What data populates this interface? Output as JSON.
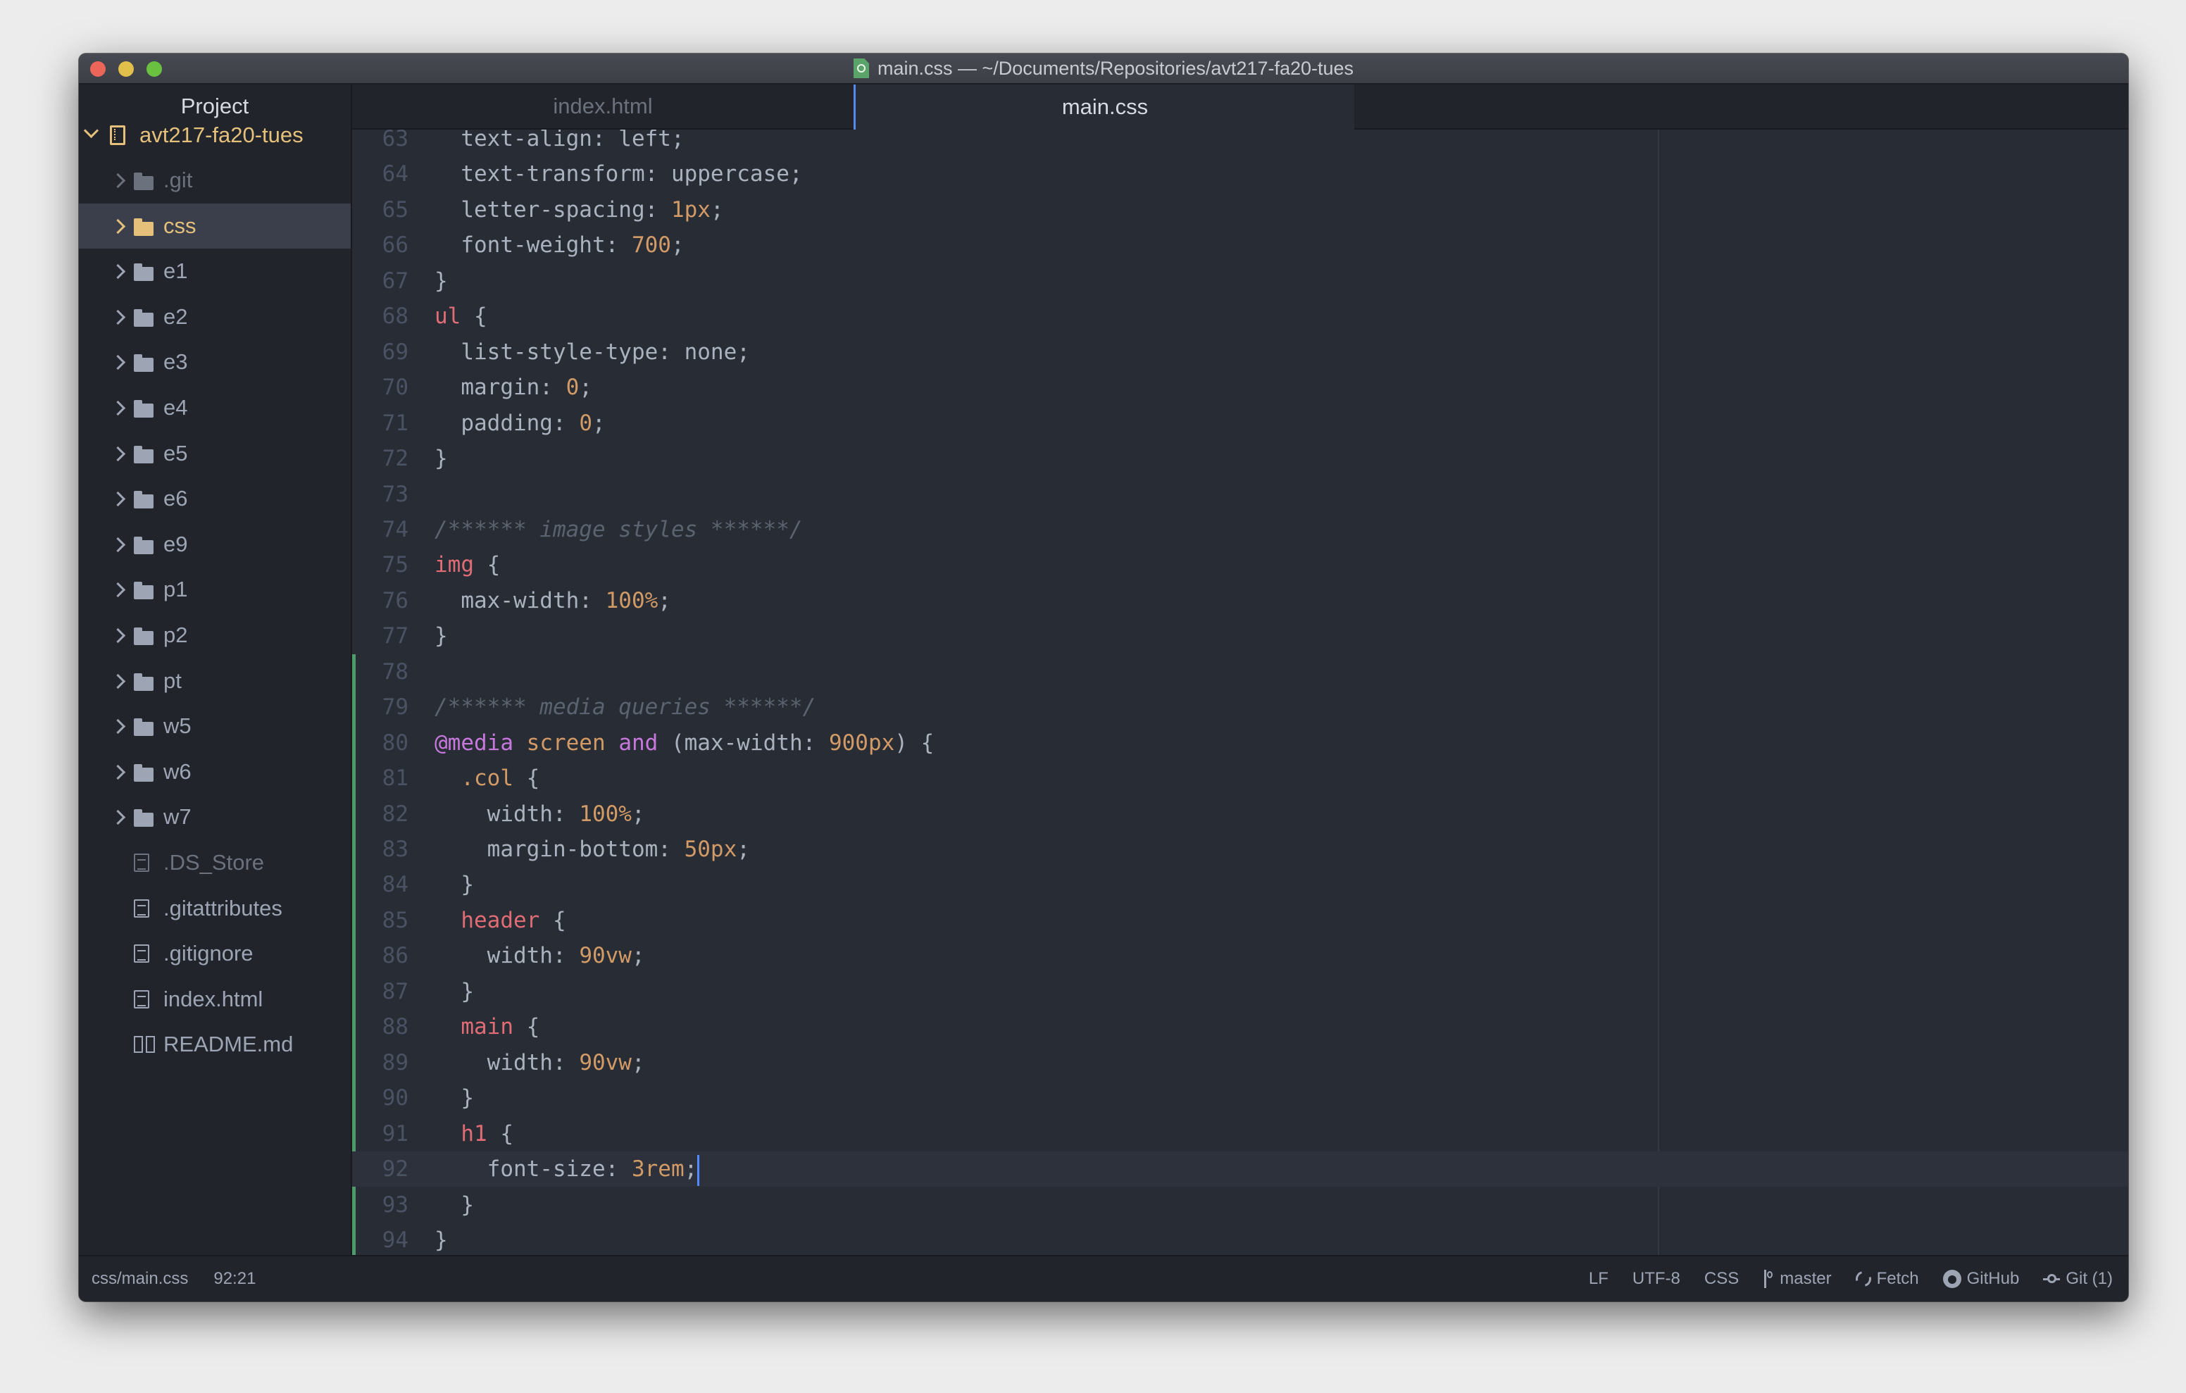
{
  "window": {
    "title": "main.css — ~/Documents/Repositories/avt217-fa20-tues",
    "title_icon": "atom-file-icon"
  },
  "sidebar": {
    "header": "Project",
    "root": {
      "label": "avt217-fa20-tues",
      "icon": "repo-icon",
      "expanded": true
    },
    "items": [
      {
        "label": ".git",
        "type": "folder",
        "state": "ignored"
      },
      {
        "label": "css",
        "type": "folder",
        "state": "modified",
        "selected": true
      },
      {
        "label": "e1",
        "type": "folder"
      },
      {
        "label": "e2",
        "type": "folder"
      },
      {
        "label": "e3",
        "type": "folder"
      },
      {
        "label": "e4",
        "type": "folder"
      },
      {
        "label": "e5",
        "type": "folder"
      },
      {
        "label": "e6",
        "type": "folder"
      },
      {
        "label": "e9",
        "type": "folder"
      },
      {
        "label": "p1",
        "type": "folder"
      },
      {
        "label": "p2",
        "type": "folder"
      },
      {
        "label": "pt",
        "type": "folder"
      },
      {
        "label": "w5",
        "type": "folder"
      },
      {
        "label": "w6",
        "type": "folder"
      },
      {
        "label": "w7",
        "type": "folder"
      },
      {
        "label": ".DS_Store",
        "type": "file",
        "state": "ignored"
      },
      {
        "label": ".gitattributes",
        "type": "file"
      },
      {
        "label": ".gitignore",
        "type": "file"
      },
      {
        "label": "index.html",
        "type": "file"
      },
      {
        "label": "README.md",
        "type": "book"
      }
    ]
  },
  "tabs": [
    {
      "label": "index.html",
      "active": false
    },
    {
      "label": "main.css",
      "active": true
    }
  ],
  "editor": {
    "cursor_line": 92,
    "lines": [
      {
        "n": "63",
        "tokens": [
          [
            "plain",
            "  text-align: left;"
          ]
        ]
      },
      {
        "n": "64",
        "tokens": [
          [
            "plain",
            "  text-transform: uppercase;"
          ]
        ]
      },
      {
        "n": "65",
        "tokens": [
          [
            "plain",
            "  letter-spacing: "
          ],
          [
            "num",
            "1px"
          ],
          [
            "plain",
            ";"
          ]
        ]
      },
      {
        "n": "66",
        "tokens": [
          [
            "plain",
            "  font-weight: "
          ],
          [
            "num",
            "700"
          ],
          [
            "plain",
            ";"
          ]
        ]
      },
      {
        "n": "67",
        "tokens": [
          [
            "plain",
            "}"
          ]
        ]
      },
      {
        "n": "68",
        "tokens": [
          [
            "sel",
            "ul"
          ],
          [
            "plain",
            " {"
          ]
        ]
      },
      {
        "n": "69",
        "tokens": [
          [
            "plain",
            "  list-style-type: none;"
          ]
        ]
      },
      {
        "n": "70",
        "tokens": [
          [
            "plain",
            "  margin: "
          ],
          [
            "num",
            "0"
          ],
          [
            "plain",
            ";"
          ]
        ]
      },
      {
        "n": "71",
        "tokens": [
          [
            "plain",
            "  padding: "
          ],
          [
            "num",
            "0"
          ],
          [
            "plain",
            ";"
          ]
        ]
      },
      {
        "n": "72",
        "tokens": [
          [
            "plain",
            "}"
          ]
        ]
      },
      {
        "n": "73",
        "tokens": []
      },
      {
        "n": "74",
        "tokens": [
          [
            "com",
            "/****** image styles ******/"
          ]
        ]
      },
      {
        "n": "75",
        "tokens": [
          [
            "sel",
            "img"
          ],
          [
            "plain",
            " {"
          ]
        ]
      },
      {
        "n": "76",
        "tokens": [
          [
            "plain",
            "  max-width: "
          ],
          [
            "num",
            "100%"
          ],
          [
            "plain",
            ";"
          ]
        ]
      },
      {
        "n": "77",
        "tokens": [
          [
            "plain",
            "}"
          ]
        ]
      },
      {
        "n": "78",
        "tokens": []
      },
      {
        "n": "79",
        "tokens": [
          [
            "com",
            "/****** media queries ******/"
          ]
        ]
      },
      {
        "n": "80",
        "tokens": [
          [
            "at",
            "@media"
          ],
          [
            "plain",
            " "
          ],
          [
            "cls",
            "screen"
          ],
          [
            "plain",
            " "
          ],
          [
            "at",
            "and"
          ],
          [
            "plain",
            " (max-width: "
          ],
          [
            "num",
            "900px"
          ],
          [
            "plain",
            ") {"
          ]
        ]
      },
      {
        "n": "81",
        "tokens": [
          [
            "plain",
            "  "
          ],
          [
            "cls",
            ".col"
          ],
          [
            "plain",
            " {"
          ]
        ]
      },
      {
        "n": "82",
        "tokens": [
          [
            "plain",
            "    width: "
          ],
          [
            "num",
            "100%"
          ],
          [
            "plain",
            ";"
          ]
        ]
      },
      {
        "n": "83",
        "tokens": [
          [
            "plain",
            "    margin-bottom: "
          ],
          [
            "num",
            "50px"
          ],
          [
            "plain",
            ";"
          ]
        ]
      },
      {
        "n": "84",
        "tokens": [
          [
            "plain",
            "  }"
          ]
        ]
      },
      {
        "n": "85",
        "tokens": [
          [
            "plain",
            "  "
          ],
          [
            "sel",
            "header"
          ],
          [
            "plain",
            " {"
          ]
        ]
      },
      {
        "n": "86",
        "tokens": [
          [
            "plain",
            "    width: "
          ],
          [
            "num",
            "90vw"
          ],
          [
            "plain",
            ";"
          ]
        ]
      },
      {
        "n": "87",
        "tokens": [
          [
            "plain",
            "  }"
          ]
        ]
      },
      {
        "n": "88",
        "tokens": [
          [
            "plain",
            "  "
          ],
          [
            "sel",
            "main"
          ],
          [
            "plain",
            " {"
          ]
        ]
      },
      {
        "n": "89",
        "tokens": [
          [
            "plain",
            "    width: "
          ],
          [
            "num",
            "90vw"
          ],
          [
            "plain",
            ";"
          ]
        ]
      },
      {
        "n": "90",
        "tokens": [
          [
            "plain",
            "  }"
          ]
        ]
      },
      {
        "n": "91",
        "tokens": [
          [
            "plain",
            "  "
          ],
          [
            "sel",
            "h1"
          ],
          [
            "plain",
            " {"
          ]
        ]
      },
      {
        "n": "92",
        "tokens": [
          [
            "plain",
            "    font-size: "
          ],
          [
            "num",
            "3rem"
          ],
          [
            "plain",
            ";"
          ]
        ]
      },
      {
        "n": "93",
        "tokens": [
          [
            "plain",
            "  }"
          ]
        ]
      },
      {
        "n": "94",
        "tokens": [
          [
            "plain",
            "}"
          ]
        ]
      }
    ],
    "git_added_from_line": 78
  },
  "status": {
    "file_path": "css/main.css",
    "cursor_position": "92:21",
    "line_ending": "LF",
    "encoding": "UTF-8",
    "grammar": "CSS",
    "branch": "master",
    "fetch": "Fetch",
    "github": "GitHub",
    "git": "Git (1)"
  },
  "colors": {
    "accent": "#568af2",
    "modified": "#e5c07b",
    "git_added": "#4f9a6a",
    "selector": "#e06c75",
    "number": "#d19a66",
    "at_rule": "#c678dd",
    "comment": "#5c6370"
  }
}
